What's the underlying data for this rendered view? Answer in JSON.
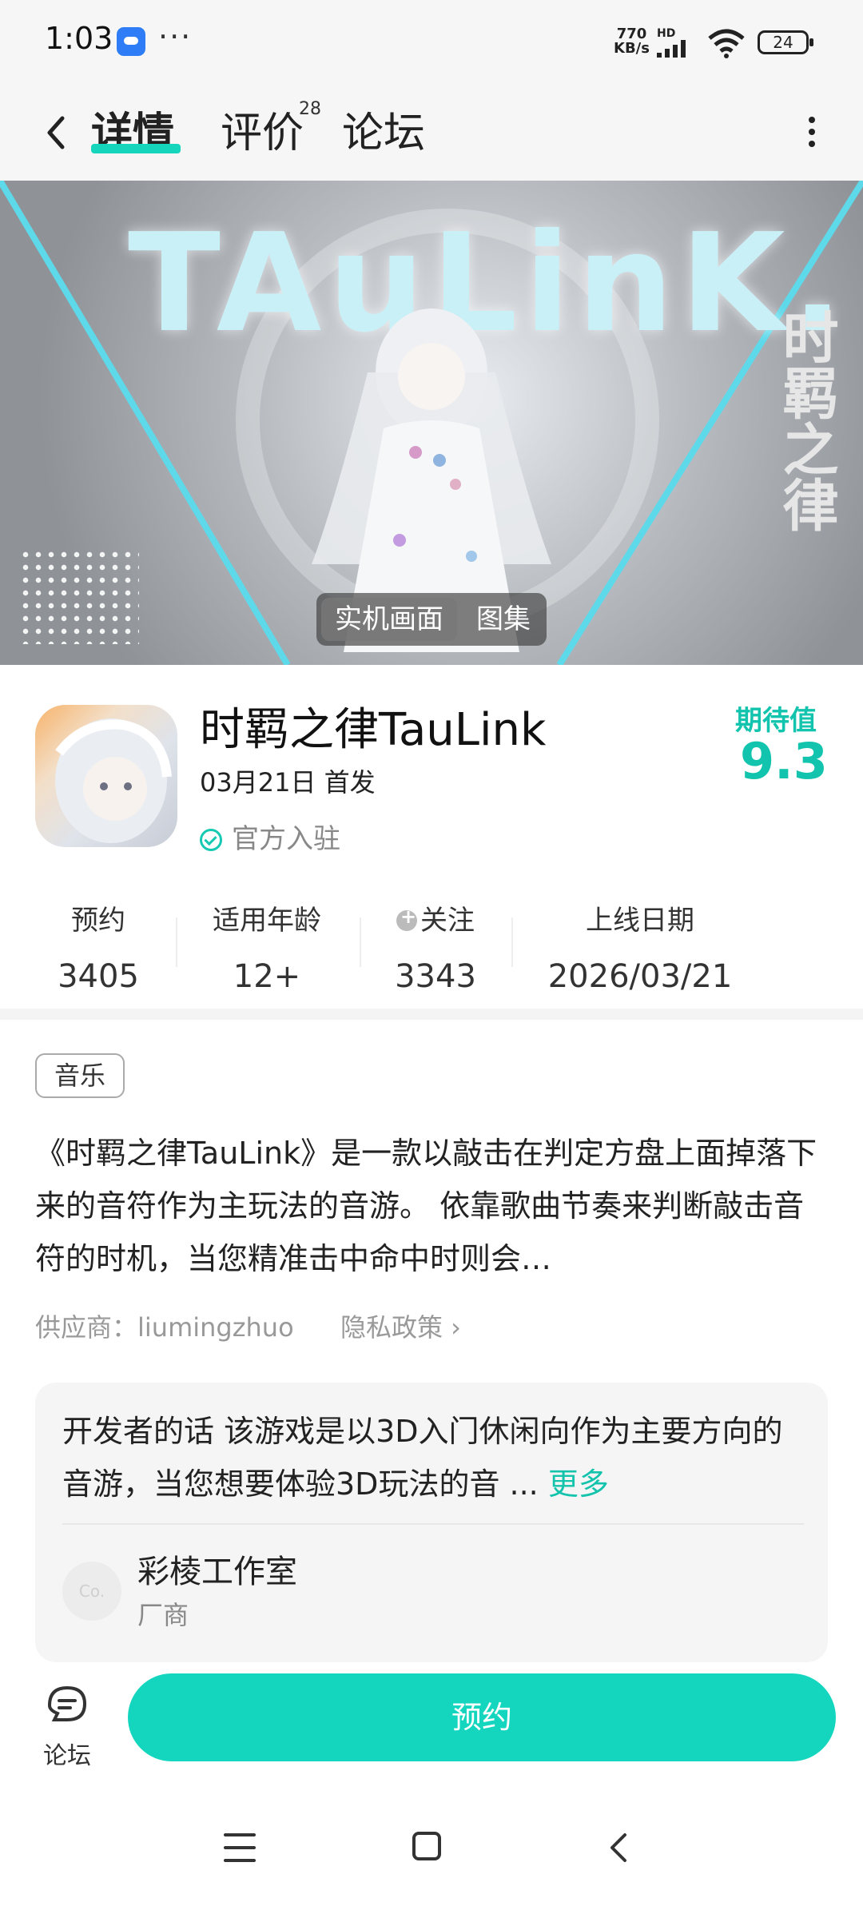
{
  "status_bar": {
    "time": "1:03",
    "menu_dots": "···",
    "network_speed_value": "770",
    "network_speed_unit": "KB/s",
    "hd_label": "HD",
    "battery": "24"
  },
  "header": {
    "tabs": [
      {
        "label": "详情"
      },
      {
        "label": "评价",
        "badge": "28"
      },
      {
        "label": "论坛"
      }
    ]
  },
  "banner": {
    "logo_text": "TAuLinK.",
    "side_title": "时羁之律",
    "toggle": [
      "实机画面",
      "图集"
    ]
  },
  "app": {
    "name": "时羁之律TauLink",
    "release": "03月21日 首发",
    "official": "官方入驻",
    "expect_label": "期待值",
    "expect_value": "9.3"
  },
  "stats": [
    {
      "label": "预约",
      "value": "3405"
    },
    {
      "label": "适用年龄",
      "value": "12+"
    },
    {
      "label": "关注",
      "value": "3343"
    },
    {
      "label": "上线日期",
      "value": "2026/03/21"
    }
  ],
  "description": {
    "tag": "音乐",
    "text": "《时羁之律TauLink》是一款以敲击在判定方盘上面掉落下来的音符作为主玩法的音游。 依靠歌曲节奏来判断敲击音符的时机，当您精准击中命中时则会…",
    "supplier": "供应商：liumingzhuo",
    "privacy": "隐私政策 ›"
  },
  "developer": {
    "text": "开发者的话  该游戏是以3D入门休闲向作为主要方向的音游，当您想要体验3D玩法的音 ...",
    "more": "更多",
    "avatar_text": "Co.",
    "name": "彩棱工作室",
    "role": "厂商"
  },
  "bottom": {
    "forum_label": "论坛",
    "reserve_label": "预约"
  },
  "colors": {
    "accent": "#14d6bf",
    "accent_text": "#12c4ad"
  }
}
